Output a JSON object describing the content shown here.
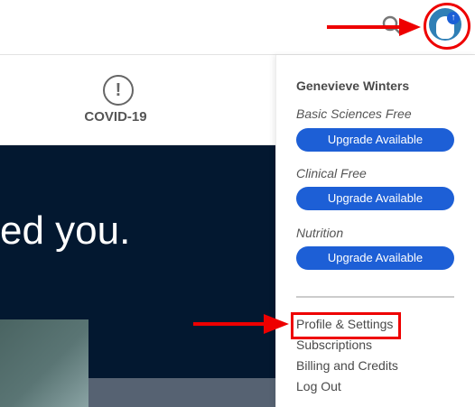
{
  "header": {
    "search_icon": "search-icon",
    "avatar_icon": "user-avatar-icon",
    "badge_icon": "upgrade-arrow-icon"
  },
  "tabs": {
    "covid_label": "COVID-19",
    "covid_icon": "alert-circle-icon"
  },
  "hero": {
    "text": "ed you."
  },
  "user_menu": {
    "name": "Genevieve Winters",
    "plans": [
      {
        "name": "Basic Sciences Free",
        "button": "Upgrade Available"
      },
      {
        "name": "Clinical Free",
        "button": "Upgrade Available"
      },
      {
        "name": "Nutrition",
        "button": "Upgrade Available"
      }
    ],
    "links": [
      "Profile & Settings",
      "Subscriptions",
      "Billing and Credits",
      "Log Out"
    ]
  },
  "colors": {
    "accent": "#1d5fd6",
    "hero_bg": "#031830",
    "annotation": "#e00000"
  }
}
